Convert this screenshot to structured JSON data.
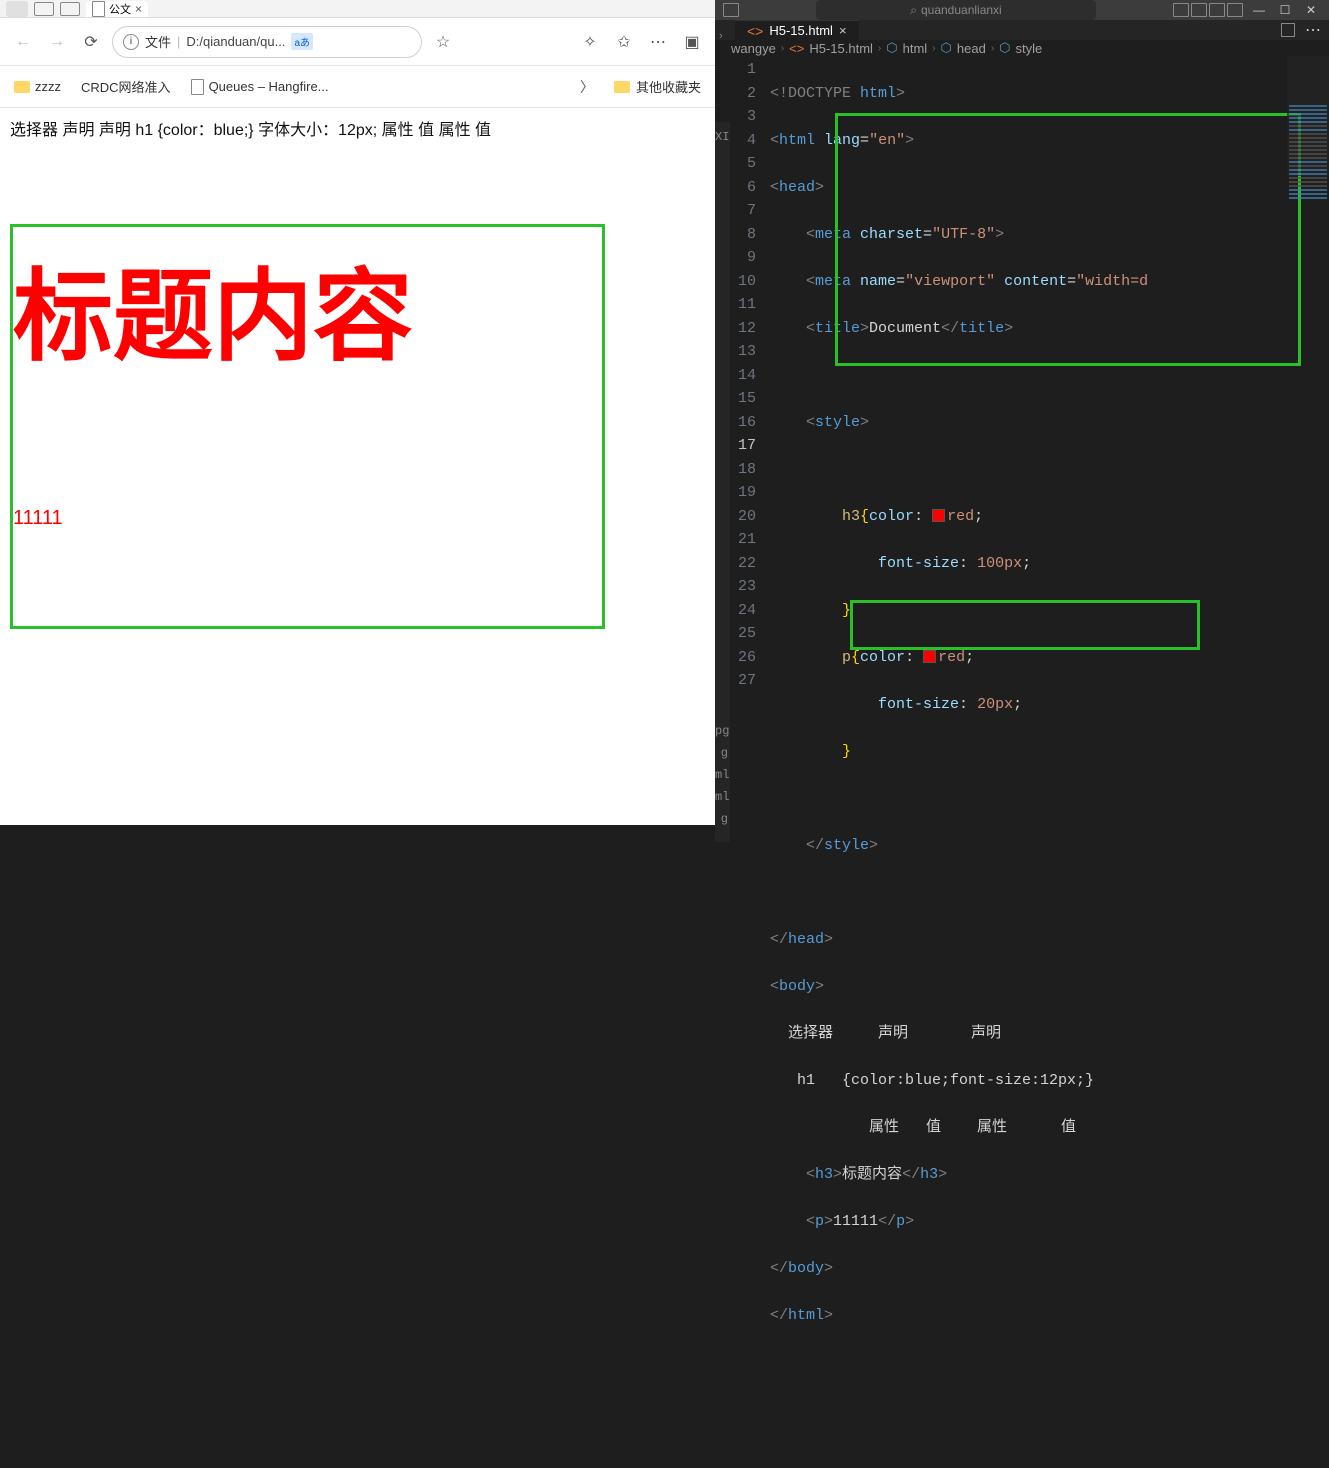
{
  "browser": {
    "tab_title": "公文",
    "url_label": "文件",
    "url_path": "D:/qianduan/qu...",
    "lang_badge": "aあ",
    "bookmarks": {
      "zzzz": "zzzz",
      "crdc": "CRDC网络准入",
      "queues": "Queues – Hangfire...",
      "other": "其他收藏夹"
    }
  },
  "page": {
    "line": "选择器 声明 声明 h1 {color：blue;} 字体大小：12px; 属性 值 属性 值",
    "h3": "标题内容",
    "p": "11111"
  },
  "vscode": {
    "search_placeholder": "quanduanlianxi",
    "tab": "H5-15.html",
    "breadcrumb": {
      "a": "wangye",
      "b": "H5-15.html",
      "c": "html",
      "d": "head",
      "e": "style"
    },
    "code": {
      "l1": {
        "doctype": "<!DOCTYPE ",
        "html": "html",
        "end": ">"
      },
      "l2": {
        "o": "<",
        "tag": "html",
        "attr": " lang",
        "eq": "=",
        "val": "\"en\"",
        "c": ">"
      },
      "l3": {
        "o": "<",
        "tag": "head",
        "c": ">"
      },
      "l4": {
        "o": "    <",
        "tag": "meta",
        "attr": " charset",
        "eq": "=",
        "val": "\"UTF-8\"",
        "c": ">"
      },
      "l5": {
        "o": "    <",
        "tag": "meta",
        "attr": " name",
        "eq": "=",
        "val": "\"viewport\"",
        "attr2": " content",
        "eq2": "=",
        "val2": "\"width=d"
      },
      "l6": {
        "o": "    <",
        "tag": "title",
        "c": ">",
        "text": "Document",
        "o2": "</",
        "tag2": "title",
        "c2": ">"
      },
      "l8": {
        "o": "    <",
        "tag": "style",
        "c": ">"
      },
      "l10": {
        "indent": "        ",
        "sel": "h3",
        "brace": "{",
        "prop": "color",
        "colon": ": ",
        "val": "red",
        "semi": ";"
      },
      "l11": {
        "indent": "            ",
        "prop": "font-size",
        "colon": ": ",
        "val": "100px",
        "semi": ";"
      },
      "l12": {
        "indent": "        ",
        "brace": "}"
      },
      "l13": {
        "indent": "        ",
        "sel": "p",
        "brace": "{",
        "prop": "color",
        "colon": ": ",
        "val": "red",
        "semi": ";"
      },
      "l14": {
        "indent": "            ",
        "prop": "font-size",
        "colon": ": ",
        "val": "20px",
        "semi": ";"
      },
      "l15": {
        "indent": "        ",
        "brace": "}"
      },
      "l17": {
        "o": "    </",
        "tag": "style",
        "c": ">"
      },
      "l19": {
        "o": "</",
        "tag": "head",
        "c": ">"
      },
      "l20": {
        "o": "<",
        "tag": "body",
        "c": ">"
      },
      "l21": {
        "text": "  选择器     声明       声明"
      },
      "l22": {
        "text": "   h1   {color:blue;font-size:12px;}"
      },
      "l23": {
        "text": "           属性   值    属性      值"
      },
      "l24": {
        "o": "    <",
        "tag": "h3",
        "c": ">",
        "text": "标题内容",
        "o2": "</",
        "tag2": "h3",
        "c2": ">"
      },
      "l25": {
        "o": "    <",
        "tag": "p",
        "c": ">",
        "text": "11111",
        "o2": "</",
        "tag2": "p",
        "c2": ">"
      },
      "l26": {
        "o": "</",
        "tag": "body",
        "c": ">"
      },
      "l27": {
        "o": "</",
        "tag": "html",
        "c": ">"
      }
    },
    "peek": [
      "XI",
      "",
      "",
      "",
      "",
      "",
      "",
      "",
      "",
      "",
      "",
      "",
      "",
      "",
      "",
      "",
      "",
      "",
      "",
      "",
      "",
      "",
      "",
      "",
      "",
      "",
      "",
      "pg",
      "g",
      "ml",
      "ml.txt",
      "g"
    ]
  }
}
